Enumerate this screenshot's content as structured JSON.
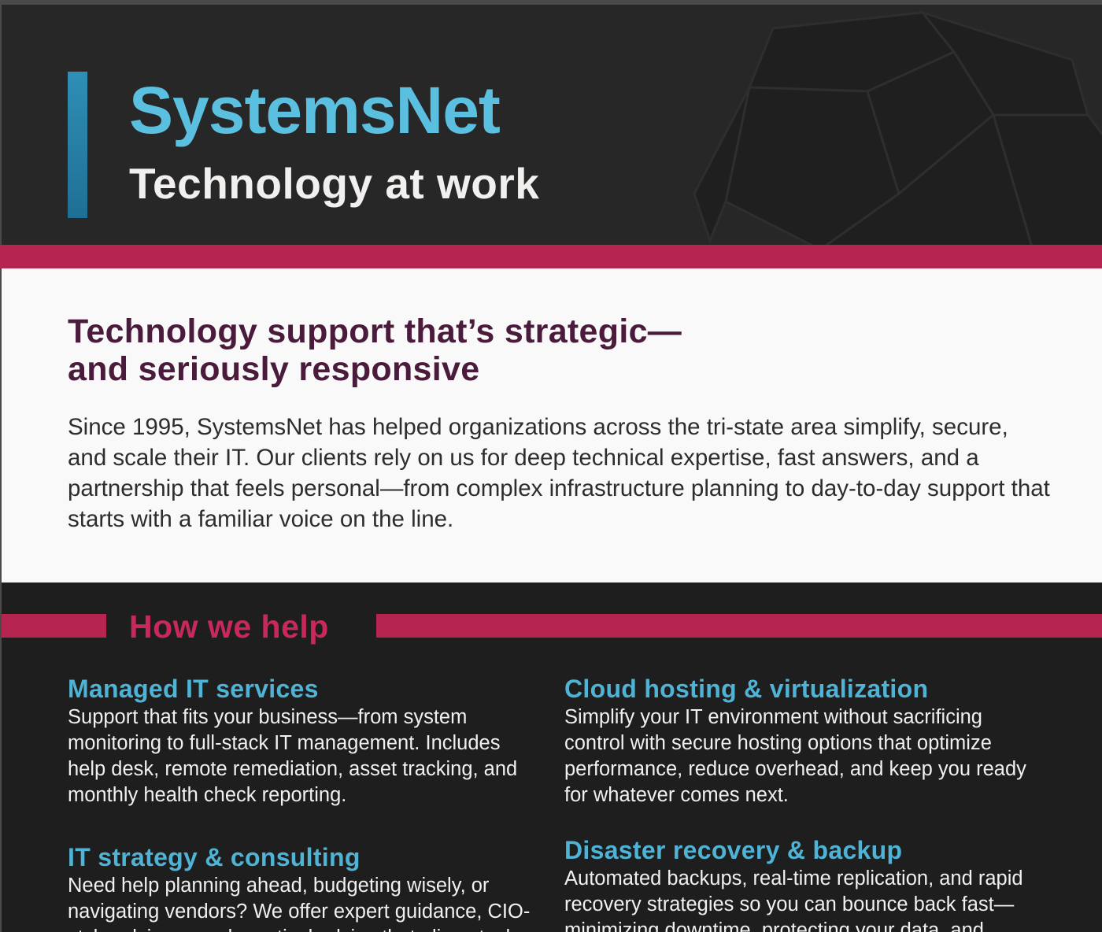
{
  "header": {
    "brand": "SystemsNet",
    "tagline": "Technology at work"
  },
  "intro": {
    "heading_line1": "Technology support that’s strategic—",
    "heading_line2": "and seriously responsive",
    "body": "Since 1995, SystemsNet has helped organizations across the tri-state area simplify, secure, and scale their IT. Our clients rely on us for deep technical expertise, fast answers, and a partnership that feels personal—from complex infrastructure planning to day-to-day support that starts with a familiar voice on the line."
  },
  "help": {
    "title": "How we help",
    "services": [
      {
        "title": "Managed IT services",
        "description": "Support that fits your business—from system monitoring to full-stack IT management. Includes help desk, remote remediation, asset tracking, and monthly health check reporting."
      },
      {
        "title": "Cloud hosting & virtualization",
        "description": "Simplify your IT environment without sacrificing control with secure hosting options that optimize performance, reduce overhead, and keep you ready for whatever comes next."
      },
      {
        "title": "IT strategy & consulting",
        "description": "Need help planning ahead, budgeting wisely, or navigating vendors? We offer expert guidance, CIO-style advisory, and practical advice that aligns tech"
      },
      {
        "title": "Disaster recovery & backup",
        "description": "Automated backups, real-time replication, and rapid recovery strategies so you can bounce back fast—minimizing downtime, protecting your data, and"
      }
    ]
  },
  "colors": {
    "header_bg": "#272728",
    "brand_blue": "#5bbfe0",
    "accent_red": "#b5254f",
    "heading_plum": "#4b1b3c",
    "service_title_blue": "#4fb3d6",
    "dark_bg": "#1e1e1f"
  },
  "icons": {
    "header_watermark": "shutter-logo-icon"
  }
}
